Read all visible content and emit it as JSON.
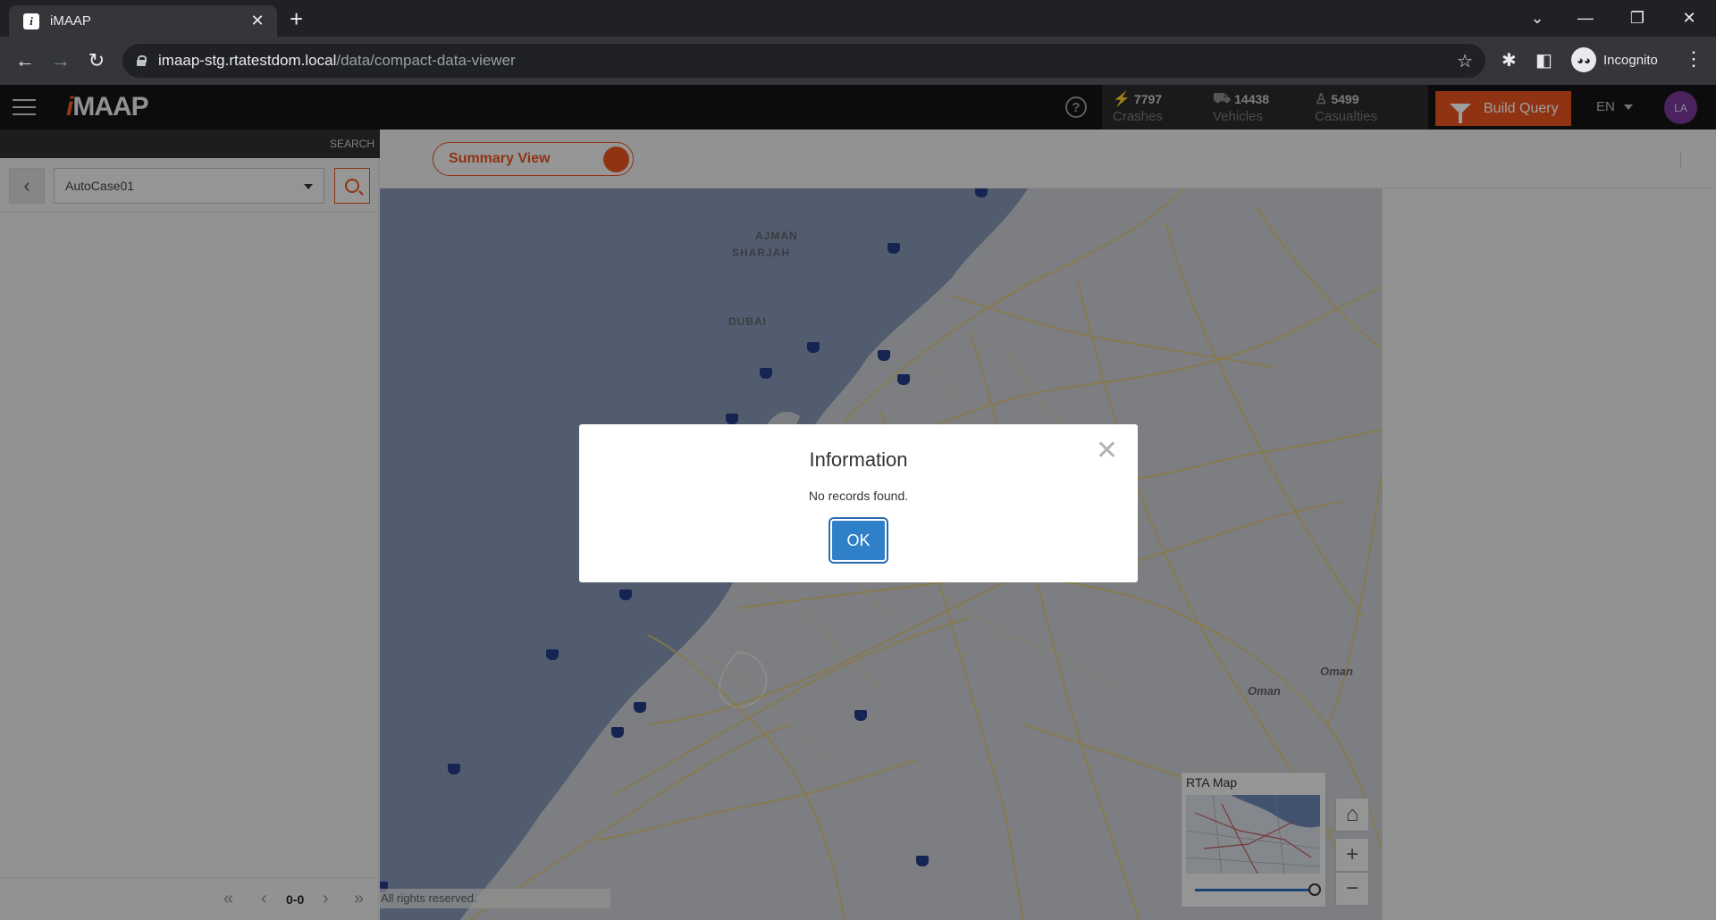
{
  "browser": {
    "tab_title": "iMAAP",
    "favicon_letter": "i",
    "url_host": "imaap-stg.rtatestdom.local",
    "url_path": "/data/compact-data-viewer",
    "incognito_label": "Incognito"
  },
  "header": {
    "logo_prefix": "i",
    "logo_text": "MAAP",
    "stats": [
      {
        "icon": "crash-icon",
        "value": "7797",
        "label": "Crashes"
      },
      {
        "icon": "vehicle-icon",
        "value": "14438",
        "label": "Vehicles"
      },
      {
        "icon": "person-icon",
        "value": "5499",
        "label": "Casualties"
      }
    ],
    "build_query_label": "Build Query",
    "language": "EN",
    "avatar_initials": "LA"
  },
  "left_panel": {
    "search_label": "SEARCH",
    "case_selected": "AutoCase01",
    "pager_count": "0-0"
  },
  "view": {
    "summary_toggle_label": "Summary View"
  },
  "map": {
    "labels": {
      "ajman": "AJMAN",
      "sharjah": "SHARJAH",
      "dubai": "DUBAI",
      "oman1": "Oman",
      "oman2": "Oman"
    },
    "copyright": "All rights reserved.",
    "overview_title": "RTA Map",
    "colors": {
      "water": "#8196b2",
      "land": "#c9ccd1",
      "roads": "#e0c36a",
      "shield": "#233a86"
    }
  },
  "modal": {
    "title": "Information",
    "message": "No records found.",
    "ok_label": "OK"
  },
  "colors": {
    "accent": "#e8531f",
    "ok_button": "#2f80c9",
    "avatar": "#7a3a9a"
  }
}
